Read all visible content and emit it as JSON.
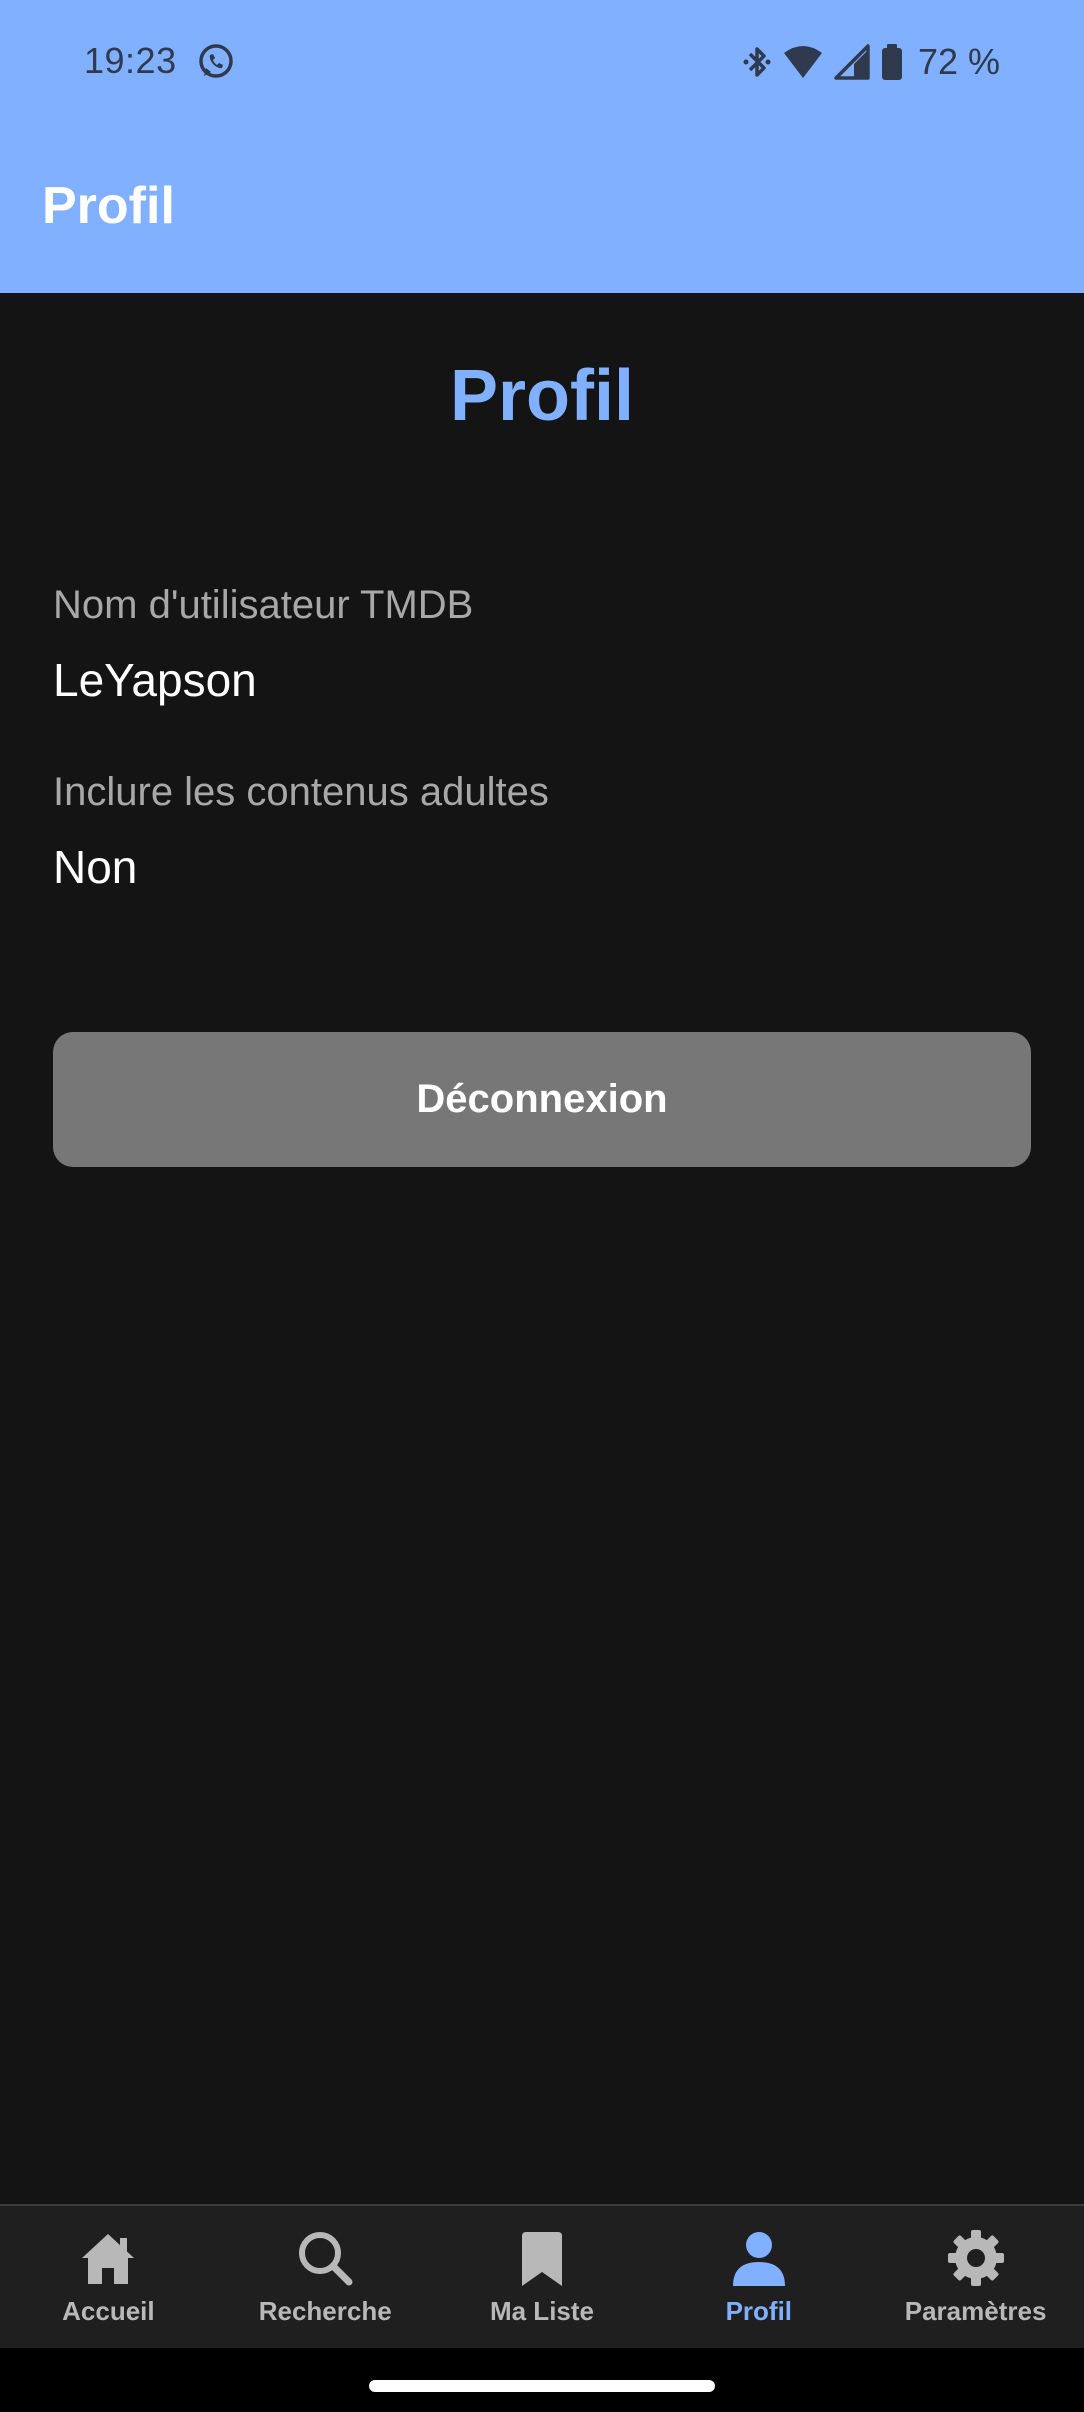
{
  "status_bar": {
    "time": "19:23",
    "battery": "72 %",
    "icons": [
      "whatsapp-icon",
      "bluetooth-icon",
      "wifi-icon",
      "signal-icon",
      "battery-icon"
    ]
  },
  "app_bar": {
    "title": "Profil"
  },
  "main": {
    "title": "Profil",
    "fields": [
      {
        "label": "Nom d'utilisateur TMDB",
        "value": "LeYapson"
      },
      {
        "label": "Inclure les contenus adultes",
        "value": "Non"
      }
    ],
    "logout_label": "Déconnexion"
  },
  "bottom_nav": {
    "items": [
      {
        "label": "Accueil",
        "icon": "home-icon",
        "active": false
      },
      {
        "label": "Recherche",
        "icon": "search-icon",
        "active": false
      },
      {
        "label": "Ma Liste",
        "icon": "bookmark-icon",
        "active": false
      },
      {
        "label": "Profil",
        "icon": "person-icon",
        "active": true
      },
      {
        "label": "Paramètres",
        "icon": "gear-icon",
        "active": false
      }
    ]
  },
  "colors": {
    "accent": "#80b0ff",
    "background": "#141414",
    "button": "#777777",
    "nav_background": "#1f1f1f"
  }
}
